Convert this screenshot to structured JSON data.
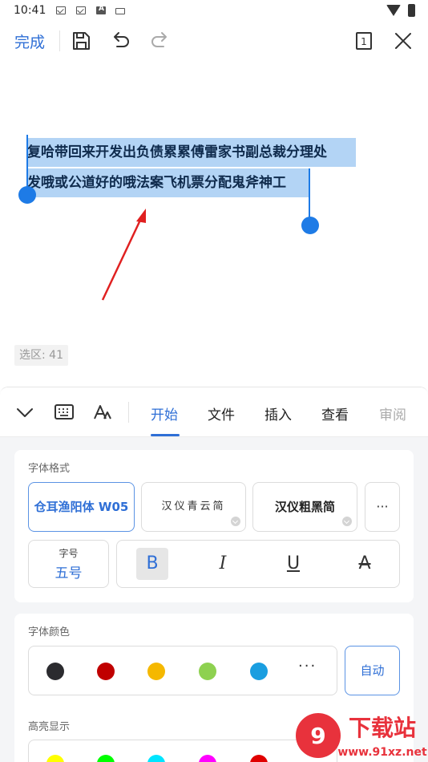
{
  "status_bar": {
    "time": "10:41"
  },
  "toolbar": {
    "done_label": "完成",
    "page_number": "1"
  },
  "document": {
    "lines": [
      "复哈带回来开发出负债累累傅雷家书副总裁分理处",
      "发哦或公道好的哦法案飞机票分配鬼斧神工"
    ],
    "selection_label": "选区: 41"
  },
  "tabs": [
    "开始",
    "文件",
    "插入",
    "查看",
    "审阅"
  ],
  "active_tab": "开始",
  "font_section": {
    "title": "字体格式",
    "fonts": [
      "仓耳渔阳体 W05",
      "汉仪青云简",
      "汉仪粗黑简"
    ],
    "more": "···",
    "size_label": "字号",
    "size_value": "五号",
    "styles": [
      "B",
      "I",
      "U",
      "A"
    ]
  },
  "color_section": {
    "title": "字体颜色",
    "swatches": [
      "#2b2b2f",
      "#c00000",
      "#f5b800",
      "#8ed150",
      "#1a9ee0"
    ],
    "more": "···",
    "auto_label": "自动"
  },
  "highlight_section": {
    "title": "高亮显示",
    "swatches": [
      "#ffff00",
      "#00ff00",
      "#00e5ff",
      "#ff00ff",
      "#e00000"
    ]
  },
  "watermark": {
    "text": "下载站",
    "url": "www.91xz.net"
  },
  "colors": {
    "accent": "#2f6fd6",
    "selection": "#b3d4f5",
    "handle": "#1e7be6"
  }
}
